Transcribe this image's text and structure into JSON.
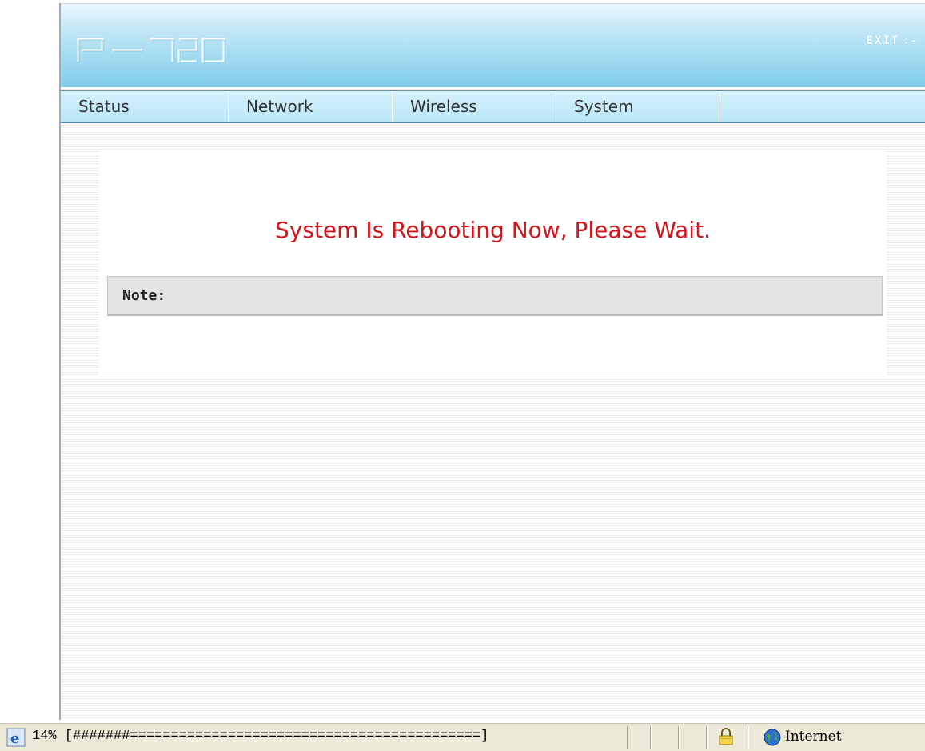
{
  "header": {
    "logo_text": "P-720",
    "exit_label": "EXIT",
    "exit_arrow": ":-"
  },
  "menu": {
    "items": [
      {
        "label": "Status"
      },
      {
        "label": "Network"
      },
      {
        "label": "Wireless"
      },
      {
        "label": "System"
      }
    ]
  },
  "main": {
    "message": "System Is Rebooting Now, Please Wait.",
    "note_label": "Note:"
  },
  "statusbar": {
    "progress_text": "14% [#######===========================================]",
    "zone": "Internet"
  },
  "colors": {
    "header_accent": "#7fcde9",
    "message": "#d4141b"
  },
  "icons": [
    "logo-icon",
    "ie-icon",
    "lock-icon",
    "globe-icon"
  ]
}
